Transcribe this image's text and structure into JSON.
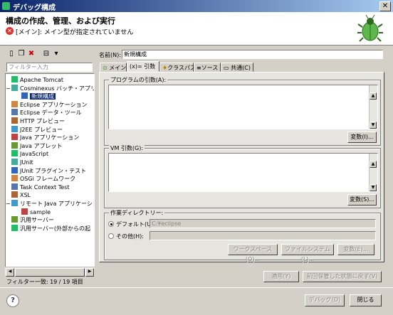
{
  "window": {
    "title": "デバッグ構成",
    "close_glyph": "✕"
  },
  "header": {
    "title": "構成の作成、管理、および実行",
    "error_glyph": "✕",
    "message": "[メイン]: メイン型が指定されていません"
  },
  "left": {
    "toolbar": [
      "new-config-icon",
      "duplicate-icon",
      "delete-icon",
      "collapse-all-icon",
      "filter-icon"
    ],
    "filter_placeholder": "フィルター入力",
    "tree": [
      {
        "label": "Apache Tomcat",
        "indent": 1
      },
      {
        "label": "Cosminexus バッチ・アプリケ",
        "indent": 1,
        "expander": "−"
      },
      {
        "label": "新規構成",
        "indent": 2,
        "selected": true
      },
      {
        "label": "Eclipse アプリケーション",
        "indent": 1
      },
      {
        "label": "Eclipse データ・ツール",
        "indent": 1
      },
      {
        "label": "HTTP プレビュー",
        "indent": 1
      },
      {
        "label": "J2EE プレビュー",
        "indent": 1
      },
      {
        "label": "Java アプリケーション",
        "indent": 1
      },
      {
        "label": "Java アプレット",
        "indent": 1
      },
      {
        "label": "JavaScript",
        "indent": 1
      },
      {
        "label": "JUnit",
        "indent": 1
      },
      {
        "label": "JUnit プラグイン・テスト",
        "indent": 1
      },
      {
        "label": "OSGi フレームワーク",
        "indent": 1
      },
      {
        "label": "Task Context Test",
        "indent": 1
      },
      {
        "label": "XSL",
        "indent": 1
      },
      {
        "label": "リモート Java アプリケーショ",
        "indent": 1,
        "expander": "−"
      },
      {
        "label": "sample",
        "indent": 2
      },
      {
        "label": "汎用サーバー",
        "indent": 1
      },
      {
        "label": "汎用サーバー(外部からの起",
        "indent": 1
      }
    ],
    "status": "フィルター一致: 19 / 19 項目"
  },
  "right": {
    "name_label": "名前(N):",
    "name_value": "新規構成",
    "tabs": [
      "メイン",
      "(x)= 引数",
      "クラスパス",
      "ソース",
      "共通(C)"
    ],
    "program_args_label": "プログラムの引数(A):",
    "program_vars_btn": "変数(I)...",
    "vm_args_label": "VM 引数(G):",
    "vm_vars_btn": "変数(S)...",
    "workdir_label": "作業ディレクトリー:",
    "default_label": "デフォルト(U):",
    "default_value": "C:¥eclipse",
    "other_label": "その他(H):",
    "workspace_btn": "ワークスペース(O)...",
    "filesystem_btn": "ファイルシステム(L)...",
    "vars_btn": "変数(E)...",
    "apply_btn": "適用(Y)",
    "revert_btn": "前回保管した状態に戻す(V)"
  },
  "footer": {
    "help": "?",
    "debug_btn": "デバッグ(D)",
    "close_btn": "閉じる"
  }
}
